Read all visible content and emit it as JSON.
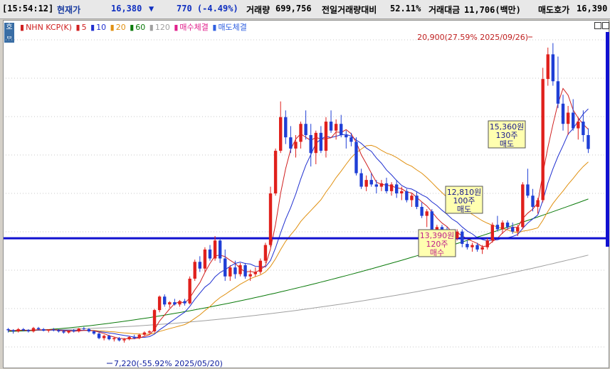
{
  "header": {
    "time": "[15:54:12]",
    "price_label": "현재가",
    "price": "16,380",
    "change_arrow": "▼",
    "change": "770 (-4.49%)",
    "volume_label": "거래량",
    "volume": "699,756",
    "prev_volume_ratio_label": "전일거래량대비",
    "prev_volume_ratio": "52.11%",
    "trade_amount_label": "거래대금",
    "trade_amount": "11,706(백만)",
    "ask_label": "매도호가",
    "ask": "16,390"
  },
  "chart_header": {
    "settings_icon_text": "호",
    "stock": "NHN KCP(K)",
    "ma_labels": [
      "5",
      "10",
      "20",
      "60",
      "120"
    ],
    "buy_fill_label": "매수체결",
    "sell_fill_label": "매도체결"
  },
  "colors": {
    "up": "#e0201c",
    "down": "#1f3fd6",
    "ma5": "#d02020",
    "ma10": "#2030d0",
    "ma20": "#e09010",
    "ma60": "#0a7a0a",
    "ma120": "#a0a0a0",
    "hline": "#1010d0",
    "annotation_bg": "#ffffb0"
  },
  "chart_data": {
    "type": "candlestick",
    "ylim": [
      6700,
      21500
    ],
    "reference_line": 12400,
    "candles": [
      [
        8350,
        8400,
        8200,
        8300
      ],
      [
        8300,
        8350,
        8150,
        8250
      ],
      [
        8250,
        8400,
        8200,
        8350
      ],
      [
        8350,
        8400,
        8250,
        8300
      ],
      [
        8300,
        8350,
        8200,
        8250
      ],
      [
        8250,
        8450,
        8200,
        8400
      ],
      [
        8400,
        8450,
        8300,
        8350
      ],
      [
        8350,
        8400,
        8250,
        8280
      ],
      [
        8280,
        8350,
        8200,
        8330
      ],
      [
        8330,
        8400,
        8250,
        8300
      ],
      [
        8300,
        8350,
        8200,
        8250
      ],
      [
        8250,
        8300,
        8150,
        8200
      ],
      [
        8200,
        8300,
        8150,
        8280
      ],
      [
        8280,
        8350,
        8200,
        8250
      ],
      [
        8250,
        8400,
        8200,
        8380
      ],
      [
        8380,
        8450,
        8300,
        8350
      ],
      [
        8350,
        8400,
        8200,
        8250
      ],
      [
        8250,
        8300,
        8100,
        8150
      ],
      [
        8150,
        8200,
        7900,
        7950
      ],
      [
        7950,
        8100,
        7850,
        8050
      ],
      [
        8050,
        8100,
        7850,
        7900
      ],
      [
        7900,
        8000,
        7800,
        7950
      ],
      [
        7950,
        8000,
        7800,
        7850
      ],
      [
        7850,
        7950,
        7750,
        7900
      ],
      [
        7900,
        8050,
        7850,
        8000
      ],
      [
        8000,
        8100,
        7900,
        7950
      ],
      [
        7950,
        8150,
        7900,
        8100
      ],
      [
        8100,
        8250,
        8050,
        8200
      ],
      [
        8200,
        8300,
        8150,
        8250
      ],
      [
        8250,
        9250,
        8200,
        9200
      ],
      [
        9200,
        9850,
        9100,
        9800
      ],
      [
        9800,
        9900,
        9350,
        9450
      ],
      [
        9450,
        9600,
        9300,
        9550
      ],
      [
        9550,
        9700,
        9400,
        9450
      ],
      [
        9450,
        9650,
        9350,
        9600
      ],
      [
        9600,
        9700,
        9400,
        9500
      ],
      [
        9500,
        10700,
        9450,
        10600
      ],
      [
        10600,
        11450,
        10500,
        11350
      ],
      [
        11350,
        11600,
        10900,
        11050
      ],
      [
        11050,
        12000,
        10900,
        11900
      ],
      [
        11900,
        12100,
        11400,
        11500
      ],
      [
        11500,
        12500,
        11400,
        12300
      ],
      [
        12300,
        12400,
        11300,
        11500
      ],
      [
        11500,
        11900,
        10500,
        10700
      ],
      [
        10700,
        11200,
        10500,
        11100
      ],
      [
        11100,
        11400,
        10600,
        10800
      ],
      [
        10800,
        11300,
        10700,
        11200
      ],
      [
        11200,
        11300,
        10600,
        10700
      ],
      [
        10700,
        11000,
        10500,
        10800
      ],
      [
        10800,
        11100,
        10700,
        10900
      ],
      [
        10900,
        11500,
        10800,
        11400
      ],
      [
        11400,
        12200,
        11300,
        12100
      ],
      [
        12100,
        14700,
        12000,
        14400
      ],
      [
        14400,
        16400,
        14300,
        16300
      ],
      [
        16300,
        18500,
        16200,
        17800
      ],
      [
        17800,
        18100,
        16600,
        16900
      ],
      [
        16900,
        17400,
        16200,
        16400
      ],
      [
        16400,
        17000,
        16000,
        16700
      ],
      [
        16700,
        17600,
        16400,
        17500
      ],
      [
        17500,
        18100,
        16800,
        17000
      ],
      [
        17000,
        17500,
        15600,
        16200
      ],
      [
        16200,
        17200,
        15700,
        17100
      ],
      [
        17100,
        17400,
        16200,
        16300
      ],
      [
        16300,
        17800,
        16000,
        17600
      ],
      [
        17600,
        18100,
        17100,
        17200
      ],
      [
        17200,
        17700,
        16800,
        17500
      ],
      [
        17500,
        17900,
        16900,
        17000
      ],
      [
        17000,
        17200,
        16400,
        16900
      ],
      [
        16900,
        17100,
        16500,
        16700
      ],
      [
        16700,
        16900,
        15200,
        15300
      ],
      [
        15300,
        15500,
        14600,
        14700
      ],
      [
        14700,
        15200,
        14500,
        15000
      ],
      [
        15000,
        15300,
        14700,
        14800
      ],
      [
        14800,
        15000,
        14400,
        14700
      ],
      [
        14700,
        15000,
        14500,
        14850
      ],
      [
        14850,
        15100,
        14400,
        14500
      ],
      [
        14500,
        14900,
        14300,
        14800
      ],
      [
        14800,
        15000,
        14200,
        14400
      ],
      [
        14400,
        14700,
        14100,
        14500
      ],
      [
        14500,
        14600,
        14000,
        14100
      ],
      [
        14100,
        14400,
        13800,
        14300
      ],
      [
        14300,
        14500,
        13700,
        13800
      ],
      [
        13800,
        14000,
        13300,
        13400
      ],
      [
        13400,
        13700,
        12900,
        13600
      ],
      [
        13600,
        13700,
        12600,
        12800
      ],
      [
        12800,
        13000,
        12400,
        12900
      ],
      [
        12900,
        13000,
        12400,
        12700
      ],
      [
        12700,
        12900,
        12300,
        12600
      ],
      [
        12600,
        12700,
        12200,
        12400
      ],
      [
        12400,
        12800,
        12300,
        12700
      ],
      [
        12700,
        12800,
        12000,
        12150
      ],
      [
        12150,
        12300,
        11900,
        12000
      ],
      [
        12000,
        12200,
        11800,
        12100
      ],
      [
        12100,
        12200,
        11800,
        11900
      ],
      [
        11900,
        12100,
        11700,
        12000
      ],
      [
        12000,
        12400,
        11900,
        12300
      ],
      [
        12300,
        13100,
        12200,
        13000
      ],
      [
        13000,
        13400,
        12700,
        12800
      ],
      [
        12800,
        13200,
        12600,
        13100
      ],
      [
        13100,
        13200,
        12800,
        12900
      ],
      [
        12900,
        13100,
        12600,
        12700
      ],
      [
        12700,
        13000,
        12500,
        12900
      ],
      [
        12900,
        14900,
        12800,
        14800
      ],
      [
        14800,
        15500,
        14200,
        14300
      ],
      [
        14300,
        14600,
        13600,
        13800
      ],
      [
        13800,
        14200,
        13500,
        14100
      ],
      [
        14100,
        20000,
        14000,
        19500
      ],
      [
        19500,
        20900,
        19200,
        20600
      ],
      [
        20600,
        21100,
        19200,
        19400
      ],
      [
        19400,
        20500,
        18200,
        18400
      ],
      [
        18400,
        18800,
        17200,
        17500
      ],
      [
        17500,
        18300,
        17000,
        18000
      ],
      [
        18000,
        18600,
        17200,
        17300
      ],
      [
        17300,
        17800,
        16800,
        17600
      ],
      [
        17600,
        18100,
        16700,
        17000
      ],
      [
        17000,
        17300,
        16200,
        16380
      ]
    ],
    "ma_values": {
      "ma20_end": 15350,
      "ma60_end": 14150,
      "ma120_end": 11650
    },
    "annotations": {
      "high_label": "20,900(27.59% 2025/09/26)",
      "low_label": "7,220(-55.92% 2025/05/20)",
      "sell1": {
        "price": "15,360원",
        "qty": "130주",
        "side": "매도"
      },
      "sell2": {
        "price": "12,810원",
        "qty": "100주",
        "side": "매도"
      },
      "buy1": {
        "price": "13,390원",
        "qty": "120주",
        "side": "매수"
      }
    }
  }
}
